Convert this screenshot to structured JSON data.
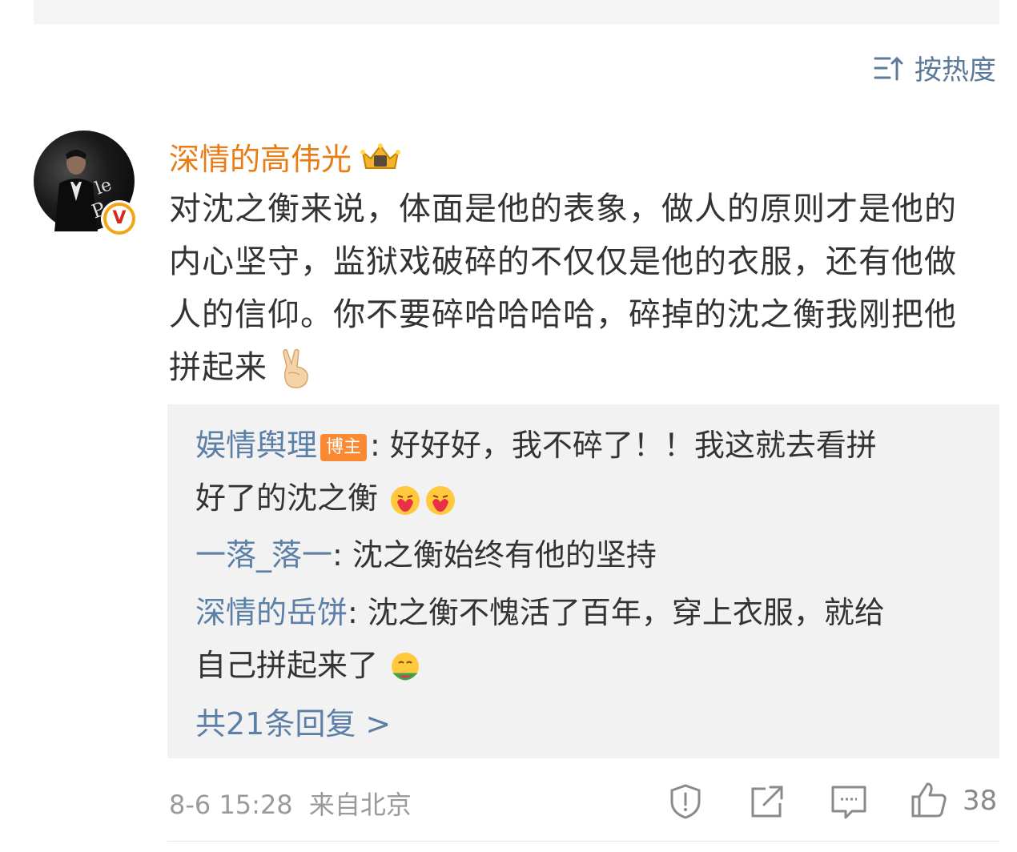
{
  "sort": {
    "label": "按热度"
  },
  "comment": {
    "username": "深情的高伟光",
    "text": "对沈之衡来说，体面是他的表象，做人的原则才是他的内心坚守，监狱戏破碎的不仅仅是他的衣服，还有他做人的信仰。你不要碎哈哈哈哈，碎掉的沈之衡我刚把他拼起来",
    "timestamp": "8-6 15:28",
    "source": "来自北京",
    "like_count": "38"
  },
  "replies": [
    {
      "name": "娱情舆理",
      "badge": "博主",
      "sep": ":",
      "text_line1": " 好好好，我不碎了！！我这就去看拼",
      "text_line2": "好了的沈之衡"
    },
    {
      "name": "一落_落一",
      "sep": ":",
      "text_line1": " 沈之衡始终有他的坚持"
    },
    {
      "name": "深情的岳饼",
      "sep": ":",
      "text_line1": " 沈之衡不愧活了百年，穿上衣服，就给",
      "text_line2": "自己拼起来了"
    }
  ],
  "more_replies": "共21条回复 >",
  "icons": {
    "sort": "sort-icon",
    "crown": "crown-badge-icon",
    "verified": "verified-v-icon",
    "report": "report-shield-icon",
    "share": "share-icon",
    "comment": "comment-icon",
    "like": "thumbs-up-icon"
  },
  "colors": {
    "username": "#ea7c16",
    "link": "#5b7fa6",
    "badge": "#f98a33",
    "meta": "#9a9a9a"
  }
}
